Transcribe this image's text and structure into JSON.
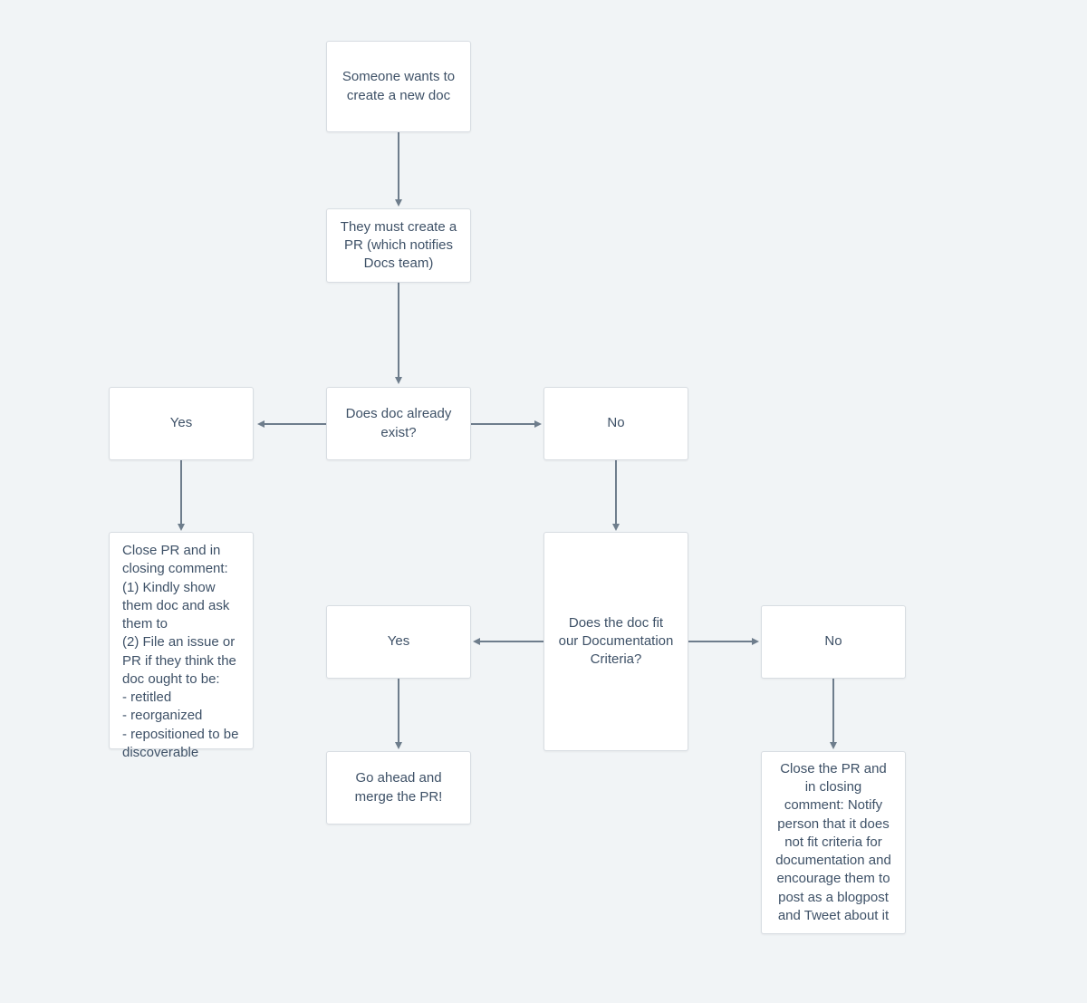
{
  "chart_data": {
    "type": "flowchart",
    "nodes": [
      {
        "id": "start",
        "text": "Someone wants to create a new doc"
      },
      {
        "id": "createPR",
        "text": "They must create a PR (which notifies Docs team)"
      },
      {
        "id": "docExists",
        "text": "Does doc already exist?"
      },
      {
        "id": "yes1",
        "text": "Yes"
      },
      {
        "id": "no1",
        "text": "No"
      },
      {
        "id": "closePR1",
        "text": "Close PR and in closing comment:\n(1) Kindly show them doc and ask them to\n(2) File an issue or PR if they think the doc ought to be:\n- retitled\n- reorganized\n- repositioned to be discoverable"
      },
      {
        "id": "criteria",
        "text": "Does the doc fit our Documentation Criteria?"
      },
      {
        "id": "yes2",
        "text": "Yes"
      },
      {
        "id": "no2",
        "text": "No"
      },
      {
        "id": "merge",
        "text": "Go ahead and merge the PR!"
      },
      {
        "id": "closePR2",
        "text": "Close the PR and in closing comment: Notify person that it does not fit criteria for documentation and encourage them to post as a blogpost and Tweet about it"
      }
    ],
    "edges": [
      {
        "from": "start",
        "to": "createPR"
      },
      {
        "from": "createPR",
        "to": "docExists"
      },
      {
        "from": "docExists",
        "to": "yes1"
      },
      {
        "from": "docExists",
        "to": "no1"
      },
      {
        "from": "yes1",
        "to": "closePR1"
      },
      {
        "from": "no1",
        "to": "criteria"
      },
      {
        "from": "criteria",
        "to": "yes2"
      },
      {
        "from": "criteria",
        "to": "no2"
      },
      {
        "from": "yes2",
        "to": "merge"
      },
      {
        "from": "no2",
        "to": "closePR2"
      }
    ]
  },
  "nodes": {
    "start": "Someone wants to create a new doc",
    "createPR": "They must create a PR (which notifies Docs team)",
    "docExists": "Does doc already exist?",
    "yes1": "Yes",
    "no1": "No",
    "closePR1": "Close PR and in closing comment:\n(1) Kindly show them doc and ask them to\n(2) File an issue or PR if they think the doc ought to be:\n- retitled\n- reorganized\n- repositioned to be discoverable",
    "criteria": "Does the doc fit our Documentation Criteria?",
    "yes2": "Yes",
    "no2": "No",
    "merge": "Go ahead and merge the PR!",
    "closePR2": "Close the PR and in closing comment: Notify person that it does not fit criteria for documentation and encourage them to post as a blogpost and Tweet about it"
  }
}
